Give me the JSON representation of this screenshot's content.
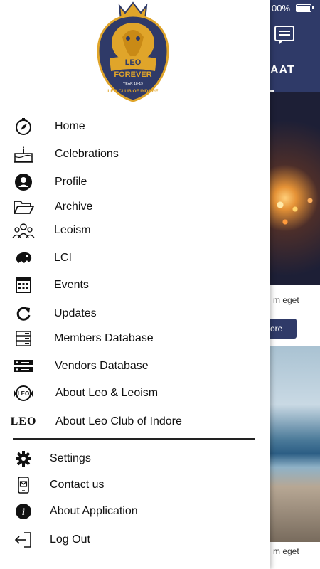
{
  "status": {
    "battery": "00%"
  },
  "background": {
    "title": "AAT",
    "card1_text": "m eget",
    "more_button": "ore",
    "card2_text": "m eget"
  },
  "logo": {
    "line1": "LEO",
    "line2": "FOREVER",
    "year": "YEAR 18-19",
    "club": "LEO CLUB OF INDORE"
  },
  "menu": [
    {
      "label": "Home",
      "icon": "compass-icon"
    },
    {
      "label": "Celebrations",
      "icon": "cake-icon"
    },
    {
      "label": "Profile",
      "icon": "user-icon"
    },
    {
      "label": "Archive",
      "icon": "folder-icon"
    },
    {
      "label": "Leoism",
      "icon": "group-icon"
    },
    {
      "label": "LCI",
      "icon": "lion-icon"
    },
    {
      "label": "Events",
      "icon": "calendar-icon"
    },
    {
      "label": "Updates",
      "icon": "refresh-icon"
    },
    {
      "label": "Members Database",
      "icon": "database-icon"
    },
    {
      "label": "Vendors Database",
      "icon": "server-icon"
    },
    {
      "label": "About Leo & Leoism",
      "icon": "emblem-icon"
    },
    {
      "label": "About Leo Club of Indore",
      "icon": "leo-wordmark-icon",
      "wordmark": "LEO"
    }
  ],
  "secondary_menu": [
    {
      "label": "Settings",
      "icon": "gear-icon"
    },
    {
      "label": "Contact us",
      "icon": "phone-mail-icon"
    },
    {
      "label": "About Application",
      "icon": "info-icon"
    },
    {
      "label": "Log Out",
      "icon": "logout-icon"
    }
  ],
  "colors": {
    "brand": "#2f3a68",
    "gold": "#e0a52a"
  }
}
